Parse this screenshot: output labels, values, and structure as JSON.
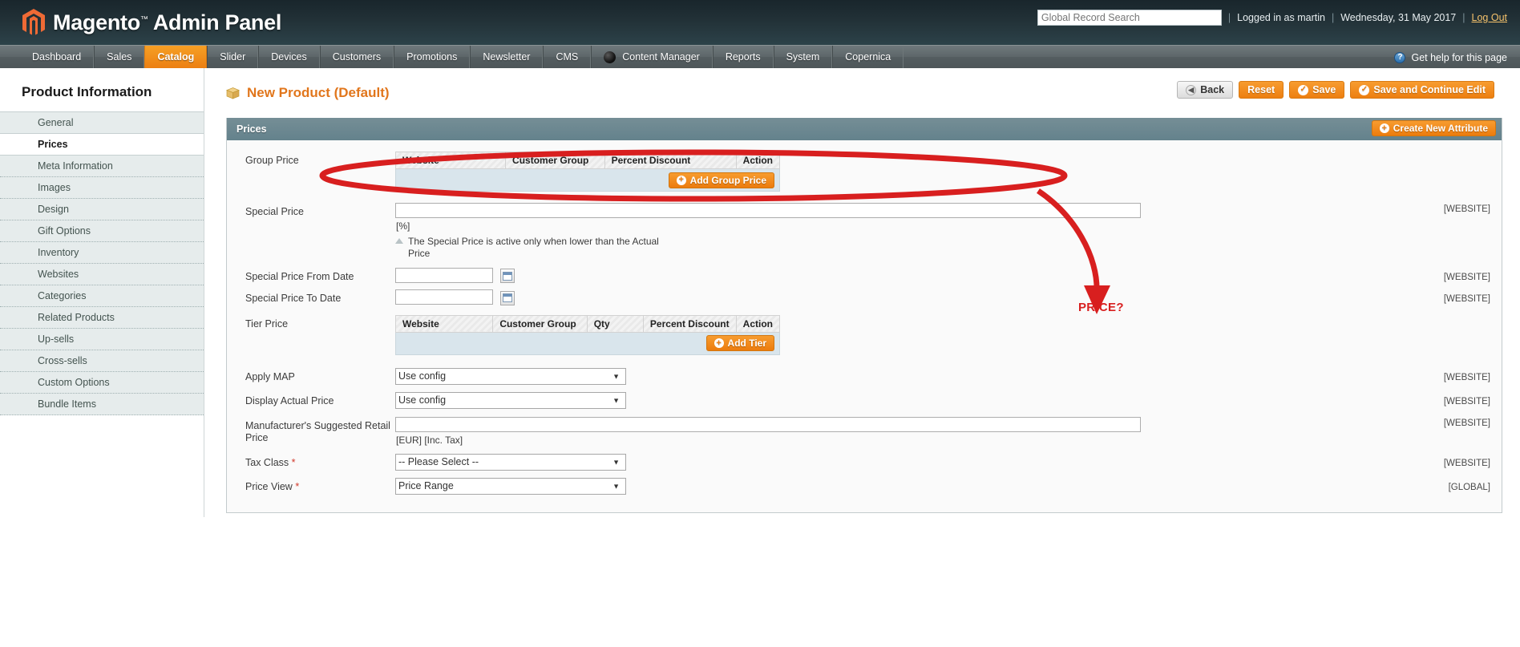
{
  "header": {
    "logo_text": "Magento",
    "logo_trademark": "™",
    "logo_suffix": "Admin Panel",
    "search_placeholder": "Global Record Search",
    "search_value": "",
    "logged_in_as": "Logged in as martin",
    "separator": "|",
    "date": "Wednesday, 31 May 2017",
    "logout": "Log Out"
  },
  "nav": {
    "items": [
      {
        "label": "Dashboard",
        "active": false,
        "icon": null
      },
      {
        "label": "Sales",
        "active": false,
        "icon": null
      },
      {
        "label": "Catalog",
        "active": true,
        "icon": null
      },
      {
        "label": "Slider",
        "active": false,
        "icon": null
      },
      {
        "label": "Devices",
        "active": false,
        "icon": null
      },
      {
        "label": "Customers",
        "active": false,
        "icon": null
      },
      {
        "label": "Promotions",
        "active": false,
        "icon": null
      },
      {
        "label": "Newsletter",
        "active": false,
        "icon": null
      },
      {
        "label": "CMS",
        "active": false,
        "icon": null
      },
      {
        "label": "Content Manager",
        "active": false,
        "icon": "content-manager-icon"
      },
      {
        "label": "Reports",
        "active": false,
        "icon": null
      },
      {
        "label": "System",
        "active": false,
        "icon": null
      },
      {
        "label": "Copernica",
        "active": false,
        "icon": null
      }
    ],
    "help_label": "Get help for this page",
    "help_icon": "question-mark-icon"
  },
  "sidebar": {
    "title": "Product Information",
    "items": [
      {
        "label": "General",
        "active": false
      },
      {
        "label": "Prices",
        "active": true
      },
      {
        "label": "Meta Information",
        "active": false
      },
      {
        "label": "Images",
        "active": false
      },
      {
        "label": "Design",
        "active": false
      },
      {
        "label": "Gift Options",
        "active": false
      },
      {
        "label": "Inventory",
        "active": false
      },
      {
        "label": "Websites",
        "active": false
      },
      {
        "label": "Categories",
        "active": false
      },
      {
        "label": "Related Products",
        "active": false
      },
      {
        "label": "Up-sells",
        "active": false
      },
      {
        "label": "Cross-sells",
        "active": false
      },
      {
        "label": "Custom Options",
        "active": false
      },
      {
        "label": "Bundle Items",
        "active": false
      }
    ]
  },
  "page": {
    "title": "New Product (Default)",
    "title_icon": "product-box-icon",
    "buttons": {
      "back": "Back",
      "reset": "Reset",
      "save": "Save",
      "save_continue": "Save and Continue Edit"
    }
  },
  "panel": {
    "title": "Prices",
    "create_attribute": "Create New Attribute"
  },
  "form": {
    "group_price": {
      "label": "Group Price",
      "columns": [
        "Website",
        "Customer Group",
        "Percent Discount",
        "Action"
      ],
      "add_button": "Add Group Price"
    },
    "special_price": {
      "label": "Special Price",
      "value": "",
      "hint": "[%]",
      "note": "The Special Price is active only when lower than the Actual Price",
      "scope": "[WEBSITE]"
    },
    "special_price_from": {
      "label": "Special Price From Date",
      "value": "",
      "scope": "[WEBSITE]",
      "icon": "calendar-icon"
    },
    "special_price_to": {
      "label": "Special Price To Date",
      "value": "",
      "scope": "[WEBSITE]",
      "icon": "calendar-icon"
    },
    "tier_price": {
      "label": "Tier Price",
      "columns": [
        "Website",
        "Customer Group",
        "Qty",
        "Percent Discount",
        "Action"
      ],
      "add_button": "Add Tier"
    },
    "apply_map": {
      "label": "Apply MAP",
      "value": "Use config",
      "scope": "[WEBSITE]"
    },
    "display_actual_price": {
      "label": "Display Actual Price",
      "value": "Use config",
      "scope": "[WEBSITE]"
    },
    "msrp": {
      "label": "Manufacturer's Suggested Retail Price",
      "value": "",
      "hint": "[EUR] [Inc. Tax]",
      "scope": "[WEBSITE]"
    },
    "tax_class": {
      "label": "Tax Class",
      "required": "*",
      "value": "-- Please Select --",
      "scope": "[WEBSITE]"
    },
    "price_view": {
      "label": "Price View",
      "required": "*",
      "value": "Price Range",
      "scope": "[GLOBAL]"
    }
  },
  "annotation": {
    "label": "PRICE?",
    "color": "#d81f1f"
  }
}
